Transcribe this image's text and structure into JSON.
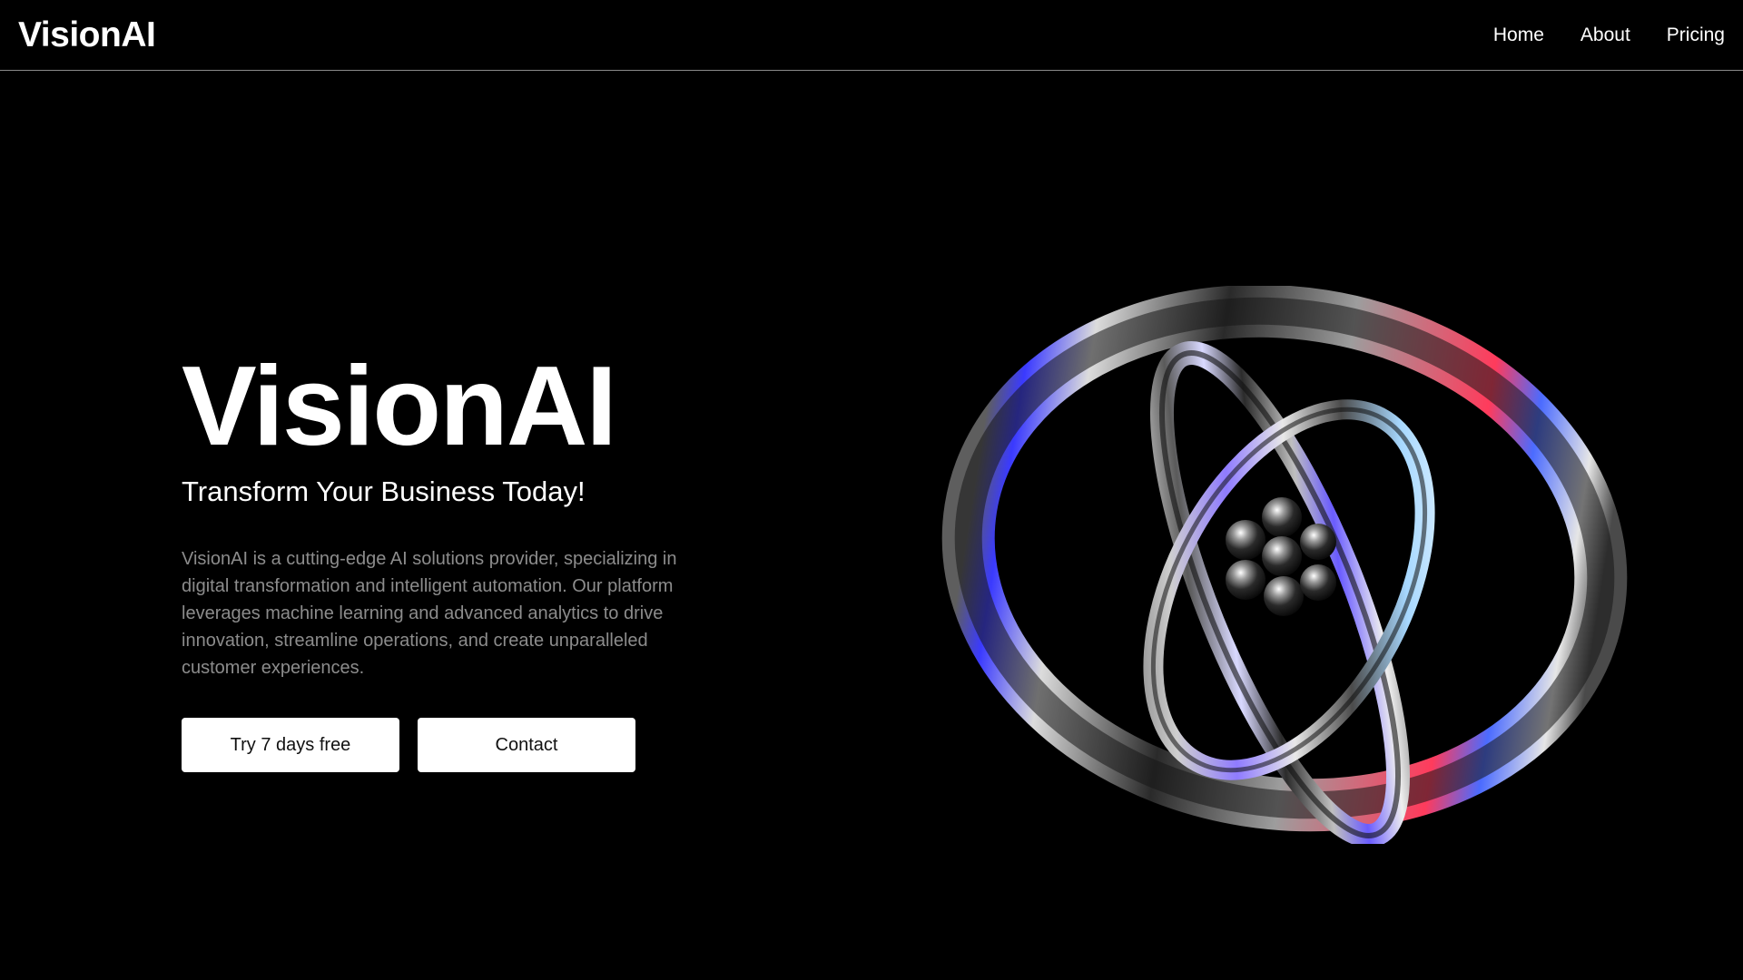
{
  "header": {
    "brand": "VisionAI",
    "nav": [
      {
        "label": "Home"
      },
      {
        "label": "About"
      },
      {
        "label": "Pricing"
      }
    ]
  },
  "hero": {
    "title": "VisionAI",
    "subtitle": "Transform Your Business Today!",
    "description": "VisionAI is a cutting-edge AI solutions provider, specializing in digital transformation and intelligent automation. Our platform leverages machine learning and advanced analytics to drive innovation, streamline operations, and create unparalleled customer experiences.",
    "buttons": {
      "trial": "Try 7 days free",
      "contact": "Contact"
    },
    "illustration_icon": "chrome-gyroscope-rings-icon"
  },
  "colors": {
    "background": "#000000",
    "text": "#ffffff",
    "muted_text": "#8c8c8c",
    "button_bg": "#ffffff",
    "button_text": "#111111",
    "divider": "#8a8a8a"
  }
}
